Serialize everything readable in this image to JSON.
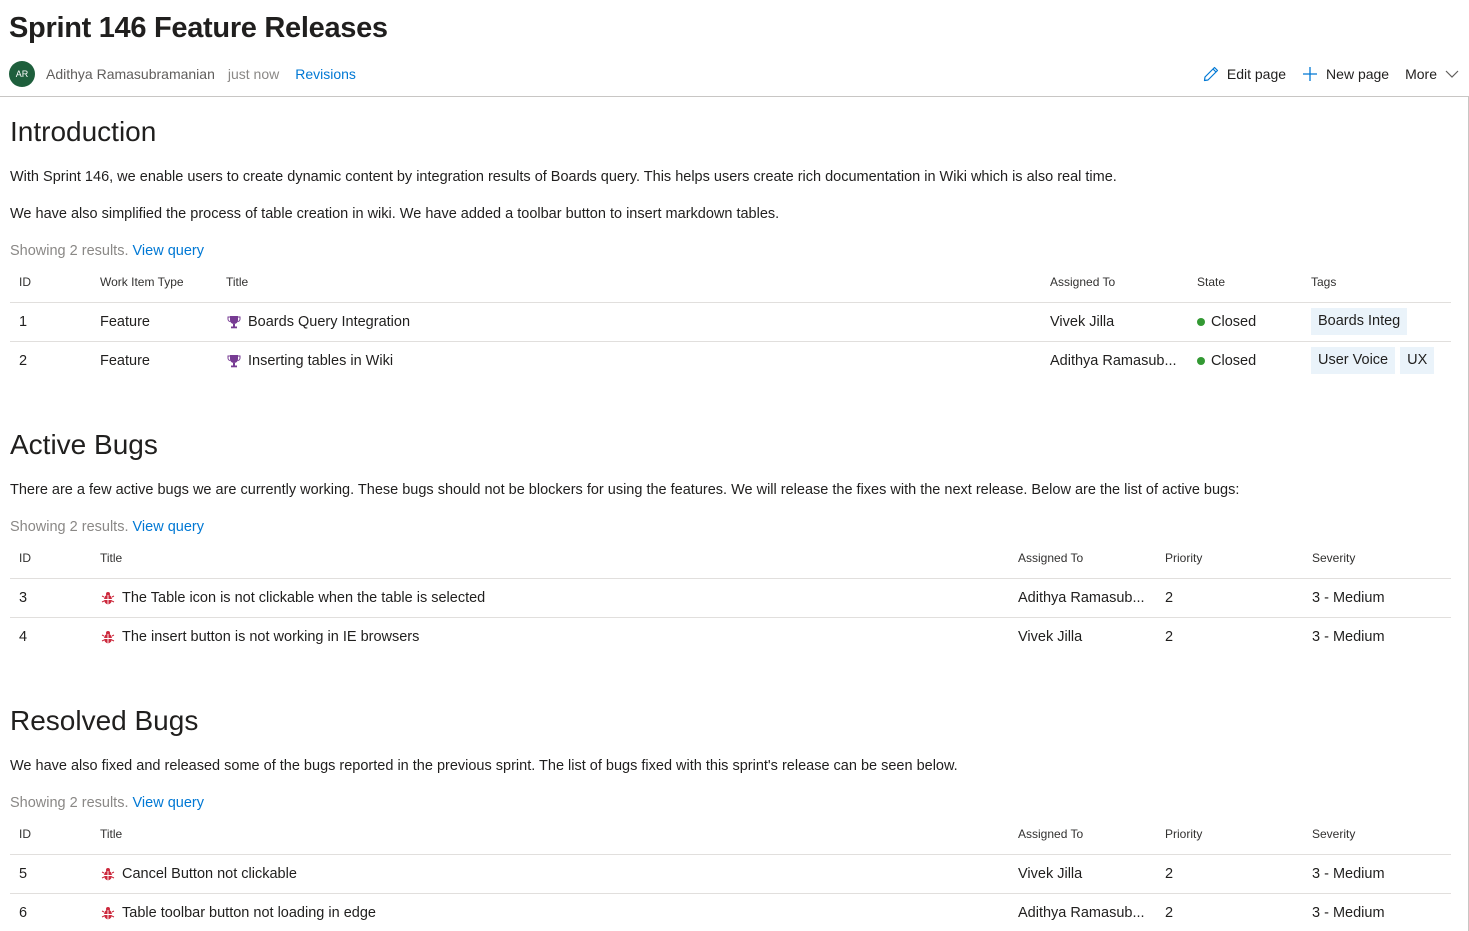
{
  "page": {
    "title": "Sprint 146 Feature Releases",
    "author_initials": "AR",
    "author": "Adithya Ramasubramanian",
    "timestamp": "just now",
    "revisions_label": "Revisions"
  },
  "actions": {
    "edit_label": "Edit page",
    "new_label": "New page",
    "more_label": "More"
  },
  "colors": {
    "link": "#0078d4",
    "feature_icon": "#773b93",
    "bug_icon": "#cc293d",
    "closed_state": "#339933",
    "tag_bg": "#eaf3fa",
    "avatar_bg": "#1e5f3c"
  },
  "sections": {
    "intro": {
      "heading": "Introduction",
      "para1": "With Sprint 146, we enable users to create dynamic content by integration results of Boards query. This helps users create rich documentation in Wiki which is also real time.",
      "para2": "We have also simplified the process of table creation in wiki. We have added a toolbar button to insert markdown tables.",
      "results_text": "Showing 2 results. ",
      "query_link": "View query",
      "columns": [
        "ID",
        "Work Item Type",
        "Title",
        "Assigned To",
        "State",
        "Tags"
      ],
      "rows": [
        {
          "id": "1",
          "type": "Feature",
          "icon": "trophy-icon",
          "title": "Boards Query Integration",
          "assigned": "Vivek Jilla",
          "state": "Closed",
          "tags": [
            "Boards Integ"
          ]
        },
        {
          "id": "2",
          "type": "Feature",
          "icon": "trophy-icon",
          "title": "Inserting tables in Wiki",
          "assigned": "Adithya Ramasub...",
          "state": "Closed",
          "tags": [
            "User Voice",
            "UX"
          ]
        }
      ]
    },
    "active": {
      "heading": "Active Bugs",
      "para1": "There are a few active bugs we are currently working. These bugs should not be blockers for using the features. We will release the fixes with the next release. Below are the list of active bugs:",
      "results_text": "Showing 2 results. ",
      "query_link": "View query",
      "columns": [
        "ID",
        "Title",
        "Assigned To",
        "Priority",
        "Severity"
      ],
      "rows": [
        {
          "id": "3",
          "icon": "bug-icon",
          "title": "The Table icon is not clickable when the table is selected",
          "assigned": "Adithya Ramasub...",
          "priority": "2",
          "severity": "3 - Medium"
        },
        {
          "id": "4",
          "icon": "bug-icon",
          "title": "The insert button is not working in IE browsers",
          "assigned": "Vivek Jilla",
          "priority": "2",
          "severity": "3 - Medium"
        }
      ]
    },
    "resolved": {
      "heading": "Resolved Bugs",
      "para1": "We have also fixed and released some of the bugs reported in the previous sprint. The list of bugs fixed with this sprint's release can be seen below.",
      "results_text": "Showing 2 results. ",
      "query_link": "View query",
      "columns": [
        "ID",
        "Title",
        "Assigned To",
        "Priority",
        "Severity"
      ],
      "rows": [
        {
          "id": "5",
          "icon": "bug-icon",
          "title": "Cancel Button not clickable",
          "assigned": "Vivek Jilla",
          "priority": "2",
          "severity": "3 - Medium"
        },
        {
          "id": "6",
          "icon": "bug-icon",
          "title": "Table toolbar button not loading in edge",
          "assigned": "Adithya Ramasub...",
          "priority": "2",
          "severity": "3 - Medium"
        }
      ]
    }
  }
}
